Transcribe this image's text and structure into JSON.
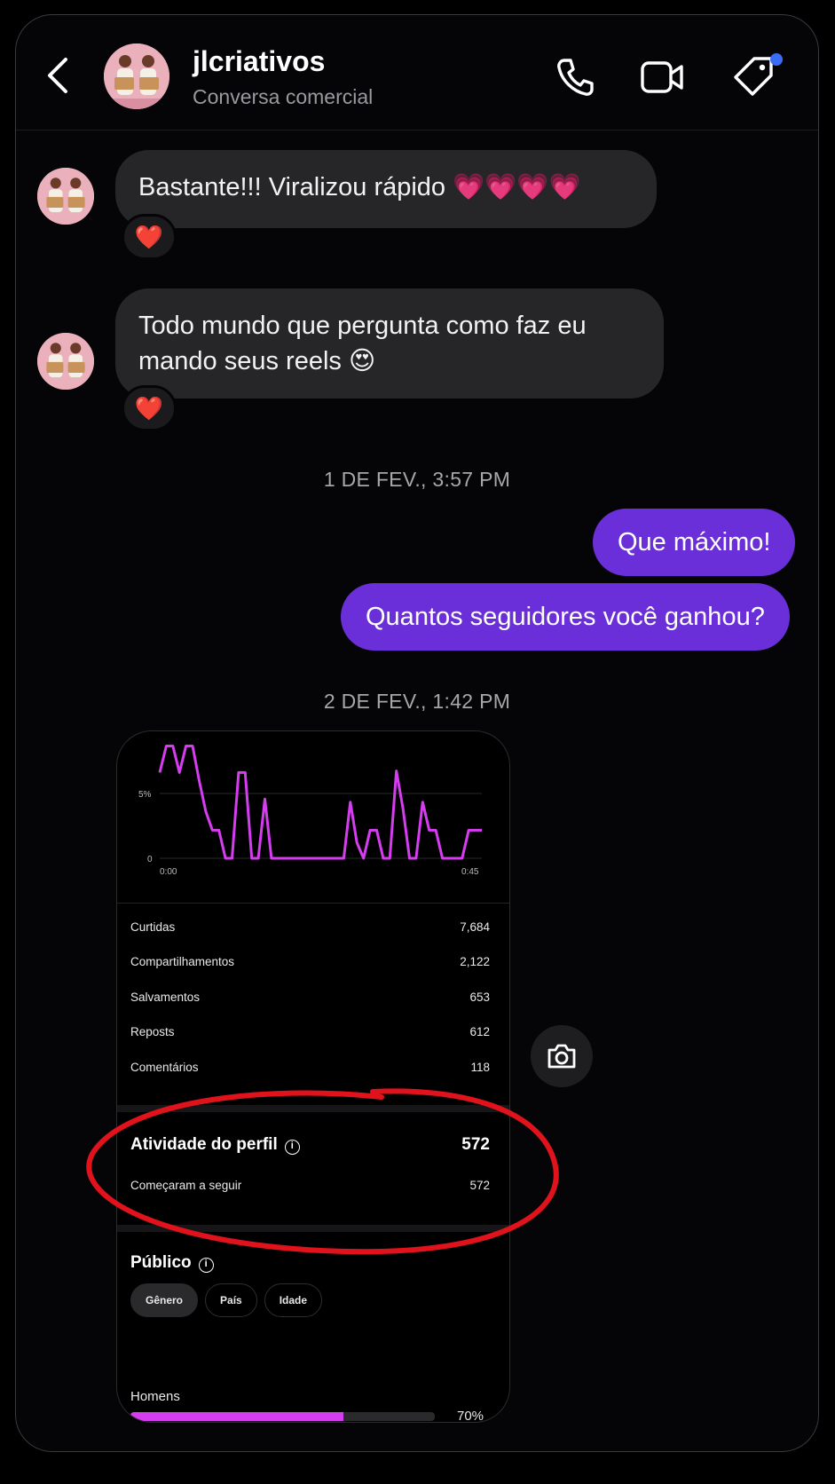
{
  "header": {
    "username": "jlcriativos",
    "subtitle": "Conversa comercial",
    "icons": [
      "back-arrow-icon",
      "phone-icon",
      "video-camera-icon",
      "tag-icon"
    ]
  },
  "messages": [
    {
      "from": "them",
      "text": "Bastante!!! Viralizou rápido 💗💗💗💗",
      "reaction": "❤️"
    },
    {
      "from": "them",
      "text": "Todo mundo que pergunta como faz eu mando seus reels 😍",
      "reaction": "❤️"
    },
    {
      "from": "me",
      "text": "Que máximo!"
    },
    {
      "from": "me",
      "text": "Quantos seguidores você ganhou?"
    }
  ],
  "timestamps": [
    "1 DE FEV., 3:57 PM",
    "2 DE FEV., 1:42 PM"
  ],
  "shared_screenshot": {
    "chart": {
      "y_ticks": [
        "5%",
        "0"
      ],
      "x_ticks": [
        "0:00",
        "0:45"
      ]
    },
    "stats": [
      {
        "label": "Curtidas",
        "value": "7,684"
      },
      {
        "label": "Compartilhamentos",
        "value": "2,122"
      },
      {
        "label": "Salvamentos",
        "value": "653"
      },
      {
        "label": "Reposts",
        "value": "612"
      },
      {
        "label": "Comentários",
        "value": "118"
      }
    ],
    "activity": {
      "title": "Atividade do perfil",
      "total": "572",
      "row_label": "Começaram a seguir",
      "row_value": "572"
    },
    "audience": {
      "title": "Público",
      "chips": [
        "Gênero",
        "País",
        "Idade"
      ],
      "selected_chip": "Gênero",
      "bar_label": "Homens",
      "bar_percent": "70%",
      "bar_fraction": 0.7
    }
  },
  "colors": {
    "outgoing_bubble": "#6a2fd8",
    "incoming_bubble": "#262628",
    "chart_line": "#d63df0",
    "annotation_circle": "#e0121b",
    "notification_dot": "#3b6cf6"
  },
  "chart_data": {
    "type": "line",
    "x_start": "0:00",
    "x_end": "0:45",
    "yticks": [
      "0",
      "5%"
    ],
    "y_unit": "%",
    "ylim": [
      0,
      7
    ],
    "values": [
      5.5,
      7.2,
      7.2,
      5.5,
      7.2,
      7.2,
      5,
      3,
      1.8,
      1.8,
      0,
      0,
      5.5,
      5.5,
      0,
      0,
      3.8,
      0,
      0,
      0,
      0,
      0,
      0,
      0,
      0,
      0,
      0,
      0,
      0,
      3.6,
      1,
      0,
      1.8,
      1.8,
      0,
      0,
      5.6,
      3.2,
      0,
      0,
      3.6,
      1.8,
      1.8,
      0,
      0,
      0,
      0,
      1.8,
      1.8,
      1.8
    ],
    "series": [
      {
        "color": "#d63df0"
      }
    ]
  }
}
